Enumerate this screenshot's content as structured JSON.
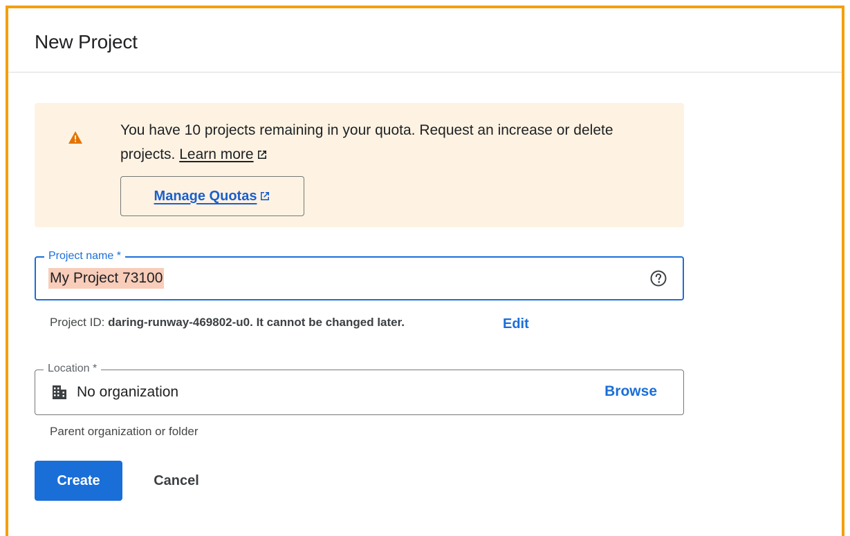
{
  "dialog": {
    "title": "New Project"
  },
  "quota_alert": {
    "icon": "warning-icon",
    "color": "#e37400",
    "message": "You have 10 projects remaining in your quota. Request an increase or delete projects.",
    "learn_more_label": "Learn more",
    "manage_quotas_label": "Manage Quotas"
  },
  "project_name": {
    "label": "Project name *",
    "value": "My Project 73100",
    "help_icon": "help-circle-icon"
  },
  "project_id": {
    "prefix": "Project ID:",
    "value": "daring-runway-469802-u0.",
    "suffix": "It cannot be changed later.",
    "edit_label": "Edit"
  },
  "location": {
    "label": "Location *",
    "icon": "building-icon",
    "value": "No organization",
    "browse_label": "Browse",
    "helper_text": "Parent organization or folder"
  },
  "actions": {
    "create_label": "Create",
    "cancel_label": "Cancel"
  },
  "colors": {
    "frame_border": "#f59f0b",
    "primary": "#1a6ed8",
    "alert_background": "#fef3e3"
  }
}
